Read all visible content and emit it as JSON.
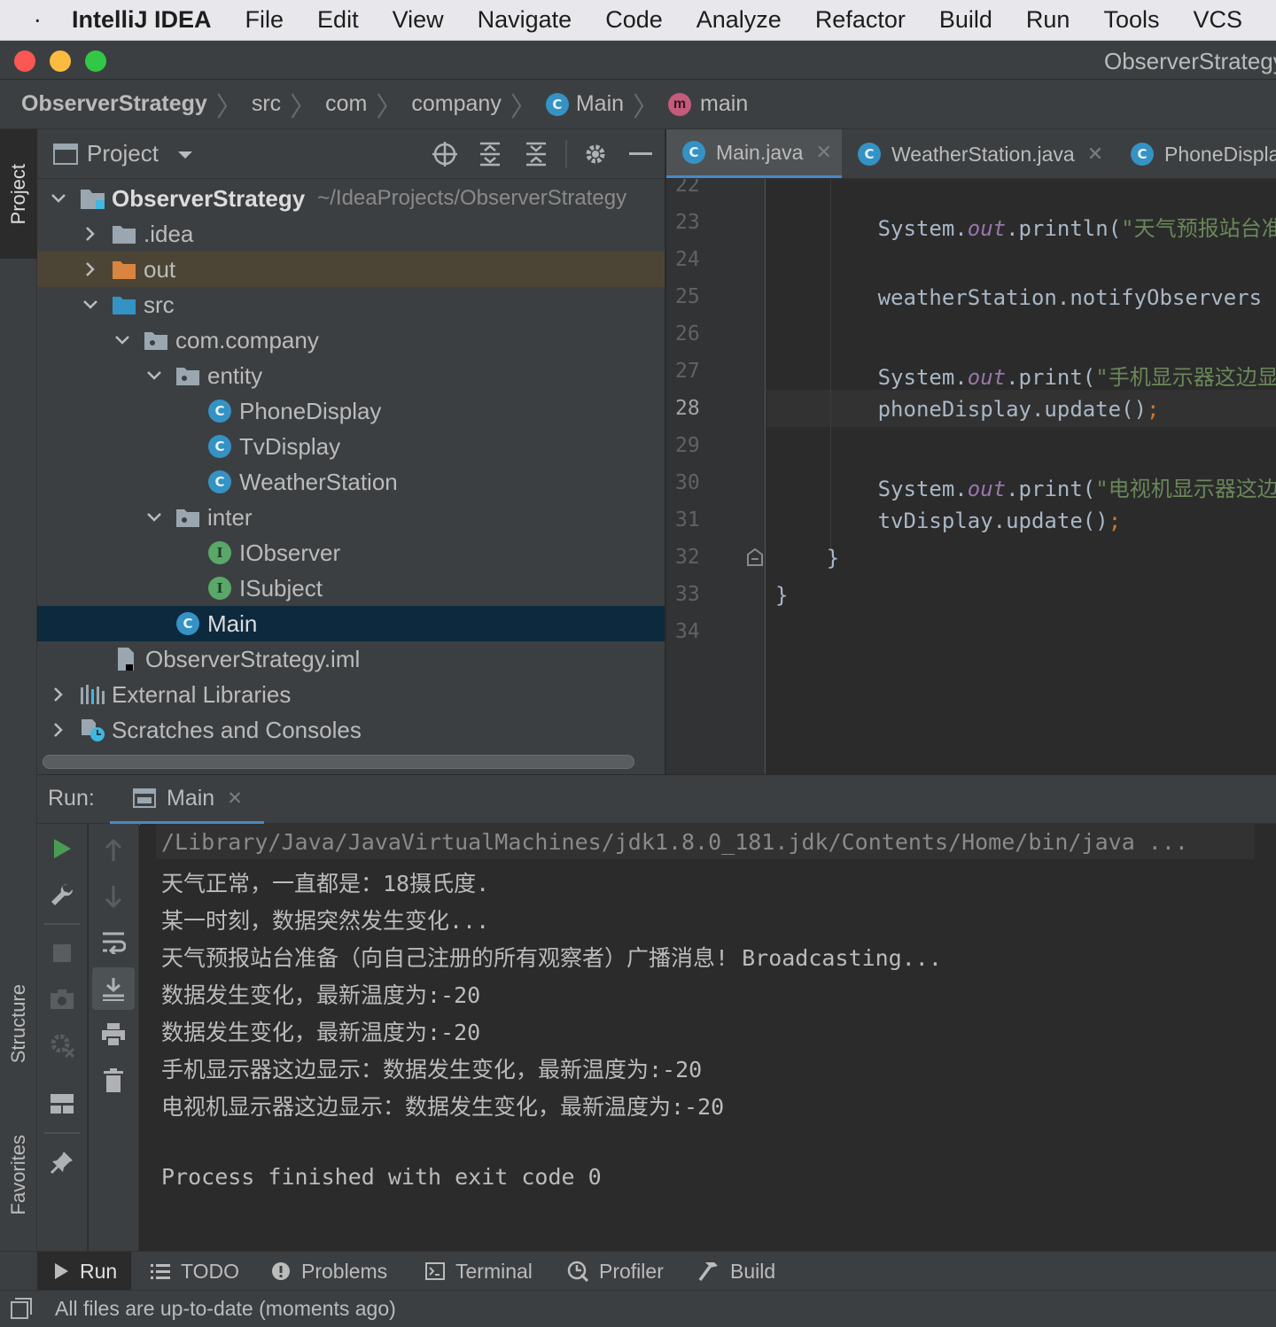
{
  "menubar": {
    "app_name": "IntelliJ IDEA",
    "items": [
      "File",
      "Edit",
      "View",
      "Navigate",
      "Code",
      "Analyze",
      "Refactor",
      "Build",
      "Run",
      "Tools",
      "VCS"
    ]
  },
  "window": {
    "title": "ObserverStrategy"
  },
  "breadcrumbs": [
    {
      "label": "ObserverStrategy",
      "icon": ""
    },
    {
      "label": "src",
      "icon": ""
    },
    {
      "label": "com",
      "icon": ""
    },
    {
      "label": "company",
      "icon": ""
    },
    {
      "label": "Main",
      "icon": "class-icon"
    },
    {
      "label": "main",
      "icon": "method-icon"
    }
  ],
  "left_strip": {
    "project": "Project",
    "structure": "Structure",
    "favorites": "Favorites"
  },
  "project_panel": {
    "title": "Project",
    "tree": [
      {
        "label": "ObserverStrategy",
        "suffix": "~/IdeaProjects/ObserverStrategy",
        "depth": 0,
        "arrow": "down",
        "icon": "module-folder-icon",
        "bold": true
      },
      {
        "label": ".idea",
        "depth": 1,
        "arrow": "right",
        "icon": "folder-icon"
      },
      {
        "label": "out",
        "depth": 1,
        "arrow": "right",
        "icon": "excluded-folder-icon"
      },
      {
        "label": "src",
        "depth": 1,
        "arrow": "down",
        "icon": "source-folder-icon"
      },
      {
        "label": "com.company",
        "depth": 2,
        "arrow": "down",
        "icon": "package-icon"
      },
      {
        "label": "entity",
        "depth": 3,
        "arrow": "down",
        "icon": "package-icon"
      },
      {
        "label": "PhoneDisplay",
        "depth": 4,
        "arrow": "",
        "icon": "class-icon"
      },
      {
        "label": "TvDisplay",
        "depth": 4,
        "arrow": "",
        "icon": "class-icon"
      },
      {
        "label": "WeatherStation",
        "depth": 4,
        "arrow": "",
        "icon": "class-icon"
      },
      {
        "label": "inter",
        "depth": 3,
        "arrow": "down",
        "icon": "package-icon"
      },
      {
        "label": "IObserver",
        "depth": 4,
        "arrow": "",
        "icon": "interface-icon"
      },
      {
        "label": "ISubject",
        "depth": 4,
        "arrow": "",
        "icon": "interface-icon"
      },
      {
        "label": "Main",
        "depth": 3,
        "arrow": "",
        "icon": "main-class-icon",
        "selected": true
      },
      {
        "label": "ObserverStrategy.iml",
        "depth": 2,
        "arrow": "",
        "icon": "iml-file-icon"
      },
      {
        "label": "External Libraries",
        "depth": 0,
        "arrow": "right",
        "icon": "libraries-icon"
      },
      {
        "label": "Scratches and Consoles",
        "depth": 0,
        "arrow": "right",
        "icon": "scratches-icon"
      }
    ]
  },
  "editor": {
    "tabs": [
      {
        "label": "Main.java",
        "active": true,
        "icon": "main-class-icon",
        "closable": true
      },
      {
        "label": "WeatherStation.java",
        "active": false,
        "icon": "class-icon",
        "closable": true
      },
      {
        "label": "PhoneDisplay.java",
        "active": false,
        "icon": "class-icon",
        "closable": false
      }
    ],
    "line_numbers": [
      "22",
      "23",
      "24",
      "25",
      "26",
      "27",
      "28",
      "29",
      "30",
      "31",
      "32",
      "33",
      "34"
    ],
    "current_line": "28",
    "lines": [
      {
        "n": "23",
        "indent": "        ",
        "parts": [
          {
            "t": "System.",
            "c": ""
          },
          {
            "t": "out",
            "c": "fld"
          },
          {
            "t": ".println(",
            "c": ""
          },
          {
            "t": "\"天气预报站台准备",
            "c": "str"
          }
        ]
      },
      {
        "n": "25",
        "indent": "        ",
        "parts": [
          {
            "t": "weatherStation.notifyObservers",
            "c": ""
          }
        ]
      },
      {
        "n": "27",
        "indent": "        ",
        "parts": [
          {
            "t": "System.",
            "c": ""
          },
          {
            "t": "out",
            "c": "fld"
          },
          {
            "t": ".print(",
            "c": ""
          },
          {
            "t": "\"手机显示器这边显示",
            "c": "str"
          }
        ]
      },
      {
        "n": "28",
        "indent": "        ",
        "parts": [
          {
            "t": "phoneDisplay.update()",
            "c": ""
          },
          {
            "t": ";",
            "c": "semi"
          }
        ]
      },
      {
        "n": "30",
        "indent": "        ",
        "parts": [
          {
            "t": "System.",
            "c": ""
          },
          {
            "t": "out",
            "c": "fld"
          },
          {
            "t": ".print(",
            "c": ""
          },
          {
            "t": "\"电视机显示器这边",
            "c": "str"
          }
        ]
      },
      {
        "n": "31",
        "indent": "        ",
        "parts": [
          {
            "t": "tvDisplay.update()",
            "c": ""
          },
          {
            "t": ";",
            "c": "semi"
          }
        ]
      },
      {
        "n": "32",
        "indent": "    ",
        "parts": [
          {
            "t": "}",
            "c": ""
          }
        ]
      },
      {
        "n": "33",
        "indent": "",
        "parts": [
          {
            "t": "}",
            "c": ""
          }
        ]
      }
    ]
  },
  "run": {
    "label": "Run:",
    "tab": "Main",
    "console": [
      "/Library/Java/JavaVirtualMachines/jdk1.8.0_181.jdk/Contents/Home/bin/java ...",
      "天气正常，一直都是：18摄氏度.",
      "某一时刻，数据突然发生变化...",
      "天气预报站台准备（向自己注册的所有观察者）广播消息! Broadcasting...",
      "数据发生变化，最新温度为:-20",
      "数据发生变化，最新温度为:-20",
      "手机显示器这边显示：数据发生变化，最新温度为:-20",
      "电视机显示器这边显示：数据发生变化，最新温度为:-20",
      "",
      "Process finished with exit code 0"
    ]
  },
  "bottom_tools": [
    {
      "label": "Run",
      "icon": "play-icon",
      "active": true
    },
    {
      "label": "TODO",
      "icon": "list-icon"
    },
    {
      "label": "Problems",
      "icon": "info-icon"
    },
    {
      "label": "Terminal",
      "icon": "terminal-icon"
    },
    {
      "label": "Profiler",
      "icon": "profiler-icon"
    },
    {
      "label": "Build",
      "icon": "hammer-icon"
    }
  ],
  "status": {
    "text": "All files are up-to-date (moments ago)"
  },
  "colors": {
    "accent_blue": "#3592c4",
    "interface_green": "#59a869",
    "selection": "#0d293e",
    "excluded_row": "#4c4535",
    "run_green": "#499c54"
  }
}
